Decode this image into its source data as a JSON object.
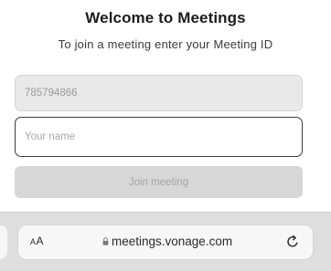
{
  "header": {
    "title": "Welcome to Meetings",
    "subtitle": "To join a meeting enter your Meeting ID"
  },
  "form": {
    "meeting_id_value": "785794866",
    "name_placeholder": "Your name",
    "join_label": "Join meeting"
  },
  "browser": {
    "text_size_label_small": "A",
    "text_size_label_large": "A",
    "url": "meetings.vonage.com",
    "icons": {
      "lock": "lock-icon",
      "reload": "reload-icon"
    }
  },
  "colors": {
    "join_disabled_bg": "#d7d7d7",
    "field_readonly_bg": "#e9e9e9",
    "toolbar_bg": "#dedede"
  }
}
